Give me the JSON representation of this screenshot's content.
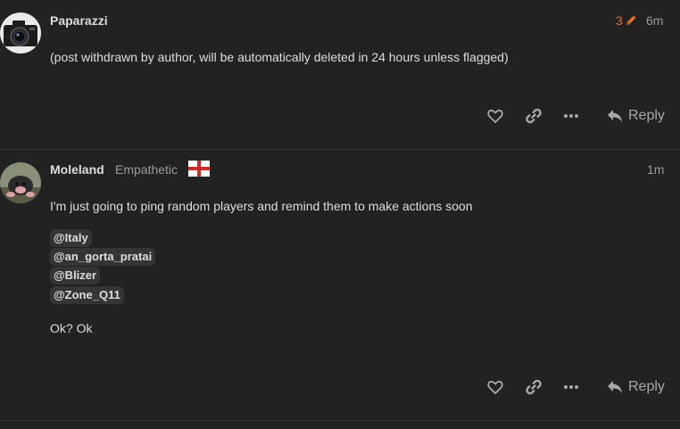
{
  "posts": [
    {
      "username": "Paparazzi",
      "edit_count": "3",
      "time": "6m",
      "text": "(post withdrawn by author, will be automatically deleted in 24 hours unless flagged)",
      "reply_label": "Reply",
      "icons": [
        "camera-avatar",
        "pencil-icon",
        "heart-icon",
        "link-icon",
        "more-icon",
        "reply-icon"
      ]
    },
    {
      "username": "Moleland",
      "user_title": "Empathetic",
      "flag": "england-flag",
      "time": "1m",
      "text": "I'm just going to ping random players and remind them to make actions soon",
      "mentions": [
        "@Italy",
        "@an_gorta_pratai",
        "@Blizer",
        "@Zone_Q11"
      ],
      "closing": "Ok? Ok",
      "reply_label": "Reply",
      "icons": [
        "mole-avatar",
        "heart-icon",
        "link-icon",
        "more-icon",
        "reply-icon"
      ]
    }
  ],
  "colors": {
    "background": "#222222",
    "text": "#dddddd",
    "muted": "#9a9a9a",
    "edit_accent": "#e46e27",
    "mention_bg": "#353535",
    "divider": "#3a3a3a"
  }
}
